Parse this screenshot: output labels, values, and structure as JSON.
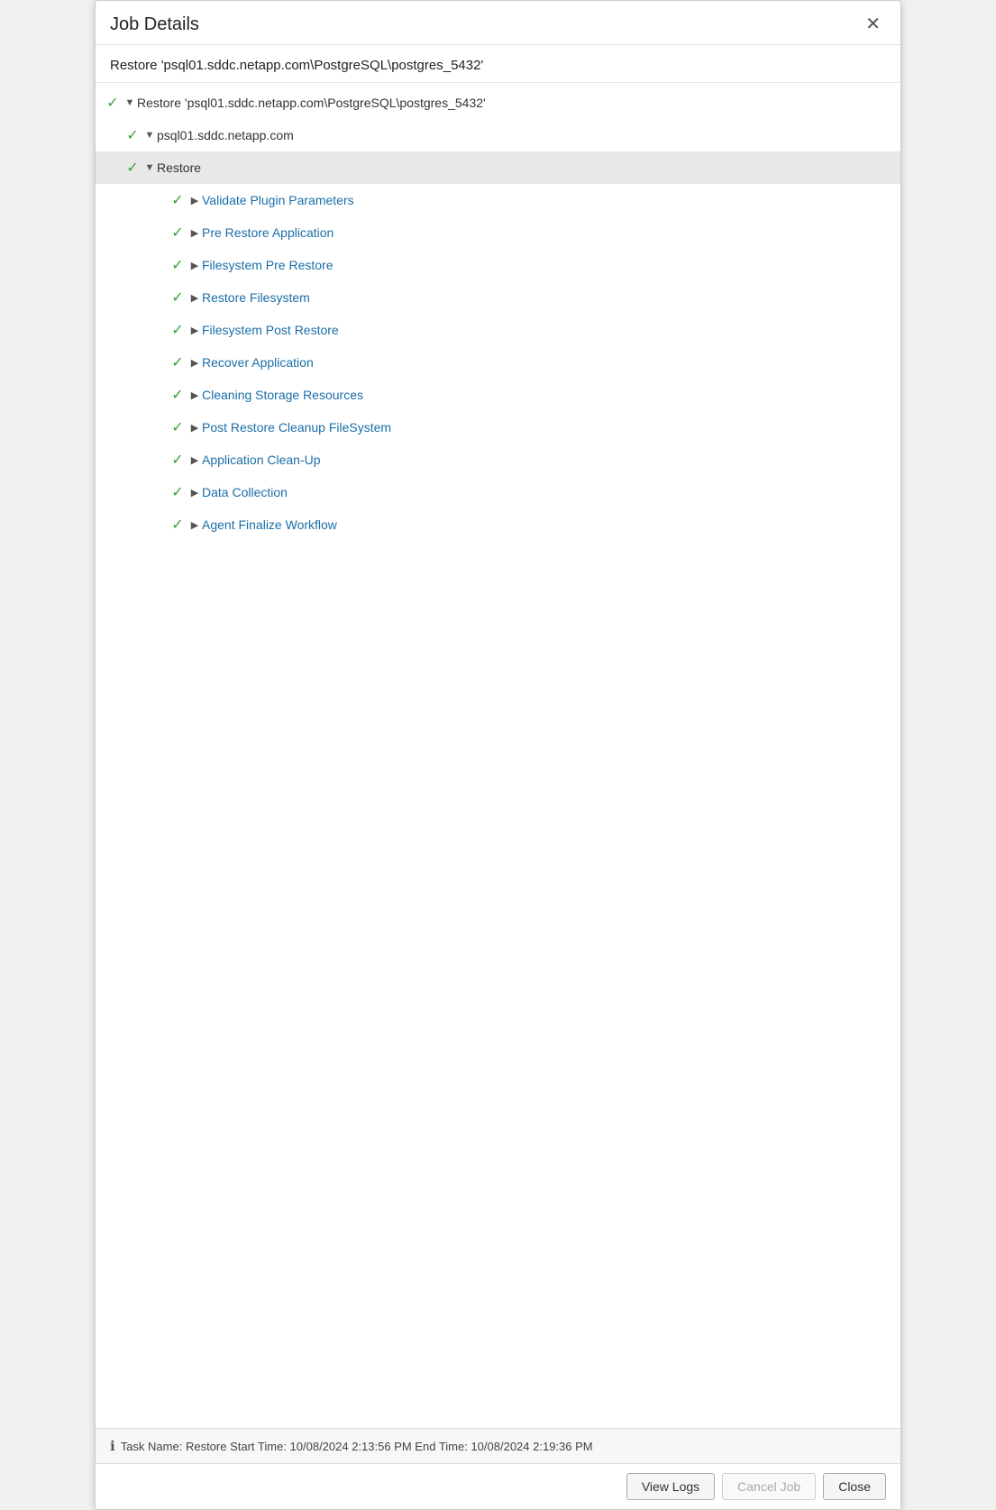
{
  "dialog": {
    "title": "Job Details",
    "close_label": "✕",
    "subtitle": "Restore 'psql01.sddc.netapp.com\\PostgreSQL\\postgres_5432'"
  },
  "footer": {
    "info_text": "Task Name: Restore Start Time: 10/08/2024 2:13:56 PM End Time: 10/08/2024 2:19:36 PM",
    "btn_view_logs": "View Logs",
    "btn_cancel_job": "Cancel Job",
    "btn_close": "Close"
  },
  "tree": {
    "rows": [
      {
        "id": "row-1",
        "indent": 1,
        "has_check": true,
        "expand_type": "triangle-down",
        "label": "Restore 'psql01.sddc.netapp.com\\PostgreSQL\\postgres_5432'",
        "is_link": false,
        "highlighted": false
      },
      {
        "id": "row-2",
        "indent": 2,
        "has_check": true,
        "expand_type": "triangle-down",
        "label": "psql01.sddc.netapp.com",
        "is_link": false,
        "highlighted": false
      },
      {
        "id": "row-3",
        "indent": 2,
        "has_check": true,
        "expand_type": "triangle-down",
        "label": "Restore",
        "is_link": false,
        "highlighted": true
      },
      {
        "id": "row-4",
        "indent": 3,
        "has_check": true,
        "expand_type": "triangle-right",
        "label": "Validate Plugin Parameters",
        "is_link": true,
        "highlighted": false
      },
      {
        "id": "row-5",
        "indent": 3,
        "has_check": true,
        "expand_type": "triangle-right",
        "label": "Pre Restore Application",
        "is_link": true,
        "highlighted": false
      },
      {
        "id": "row-6",
        "indent": 3,
        "has_check": true,
        "expand_type": "triangle-right",
        "label": "Filesystem Pre Restore",
        "is_link": true,
        "highlighted": false
      },
      {
        "id": "row-7",
        "indent": 3,
        "has_check": true,
        "expand_type": "triangle-right",
        "label": "Restore Filesystem",
        "is_link": true,
        "highlighted": false
      },
      {
        "id": "row-8",
        "indent": 3,
        "has_check": true,
        "expand_type": "triangle-right",
        "label": "Filesystem Post Restore",
        "is_link": true,
        "highlighted": false
      },
      {
        "id": "row-9",
        "indent": 3,
        "has_check": true,
        "expand_type": "triangle-right",
        "label": "Recover Application",
        "is_link": true,
        "highlighted": false
      },
      {
        "id": "row-10",
        "indent": 3,
        "has_check": true,
        "expand_type": "triangle-right",
        "label": "Cleaning Storage Resources",
        "is_link": true,
        "highlighted": false
      },
      {
        "id": "row-11",
        "indent": 3,
        "has_check": true,
        "expand_type": "triangle-right",
        "label": "Post Restore Cleanup FileSystem",
        "is_link": true,
        "highlighted": false
      },
      {
        "id": "row-12",
        "indent": 3,
        "has_check": true,
        "expand_type": "triangle-right",
        "label": "Application Clean-Up",
        "is_link": true,
        "highlighted": false
      },
      {
        "id": "row-13",
        "indent": 3,
        "has_check": true,
        "expand_type": "triangle-right",
        "label": "Data Collection",
        "is_link": true,
        "highlighted": false
      },
      {
        "id": "row-14",
        "indent": 3,
        "has_check": true,
        "expand_type": "triangle-right",
        "label": "Agent Finalize Workflow",
        "is_link": true,
        "highlighted": false
      }
    ]
  }
}
